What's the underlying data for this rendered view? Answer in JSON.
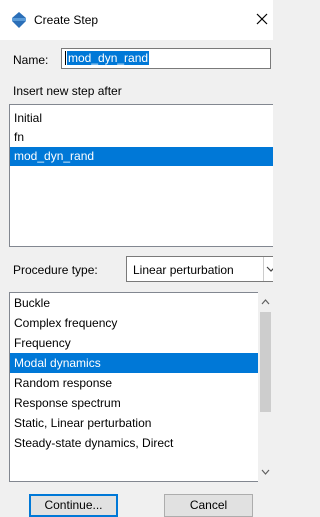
{
  "window": {
    "title": "Create Step",
    "icon": "create-step-icon",
    "close_icon": "close-icon"
  },
  "name_field": {
    "label": "Name:",
    "value": "mod_dyn_rand"
  },
  "insert_after": {
    "label": "Insert new step after",
    "items": [
      {
        "label": "Initial",
        "selected": false
      },
      {
        "label": "fn",
        "selected": false
      },
      {
        "label": "mod_dyn_rand",
        "selected": true
      }
    ]
  },
  "procedure": {
    "label": "Procedure type:",
    "selected_value": "Linear perturbation",
    "items": [
      {
        "label": "Buckle",
        "selected": false
      },
      {
        "label": "Complex frequency",
        "selected": false
      },
      {
        "label": "Frequency",
        "selected": false
      },
      {
        "label": "Modal dynamics",
        "selected": true
      },
      {
        "label": "Random response",
        "selected": false
      },
      {
        "label": "Response spectrum",
        "selected": false
      },
      {
        "label": "Static, Linear perturbation",
        "selected": false
      },
      {
        "label": "Steady-state dynamics, Direct",
        "selected": false
      }
    ]
  },
  "buttons": {
    "continue_label": "Continue...",
    "cancel_label": "Cancel"
  },
  "colors": {
    "selection": "#0078d7",
    "dialog_bg": "#f0f0f0",
    "title_bg": "#ffffff"
  }
}
